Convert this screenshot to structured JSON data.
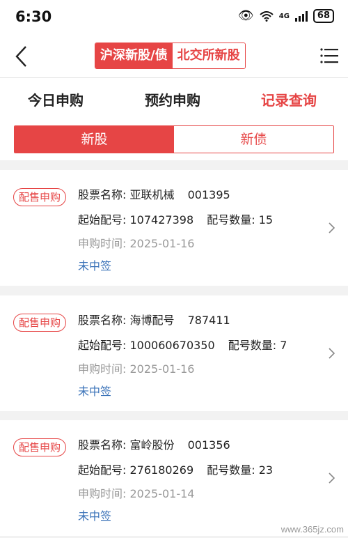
{
  "status_bar": {
    "time": "6:30",
    "signal_label": "4G",
    "battery": "68",
    "icons": [
      "eye-icon",
      "wifi-icon",
      "signal-icon",
      "battery-icon"
    ]
  },
  "navbar": {
    "back_icon": "chevron-left-icon",
    "segments": [
      {
        "label": "沪深新股/债",
        "active": true
      },
      {
        "label": "北交所新股",
        "active": false
      }
    ],
    "menu_icon": "hamburger-menu-icon"
  },
  "tabs": [
    {
      "label": "今日申购",
      "active": false
    },
    {
      "label": "预约申购",
      "active": false
    },
    {
      "label": "记录查询",
      "active": true
    }
  ],
  "subtabs": [
    {
      "label": "新股",
      "active": true
    },
    {
      "label": "新债",
      "active": false
    }
  ],
  "colors": {
    "accent": "#e64545",
    "link_blue": "#3a72b8",
    "muted": "#999999",
    "background": "#f2f2f2"
  },
  "records": [
    {
      "badge": "配售申购",
      "name_label": "股票名称:",
      "name": "亚联机械",
      "code": "001395",
      "start_label": "起始配号:",
      "start_no": "107427398",
      "count_label": "配号数量:",
      "count": "15",
      "time_label": "申购时间:",
      "date": "2025-01-16",
      "result": "未中签"
    },
    {
      "badge": "配售申购",
      "name_label": "股票名称:",
      "name": "海博配号",
      "code": "787411",
      "start_label": "起始配号:",
      "start_no": "100060670350",
      "count_label": "配号数量:",
      "count": "7",
      "time_label": "申购时间:",
      "date": "2025-01-16",
      "result": "未中签"
    },
    {
      "badge": "配售申购",
      "name_label": "股票名称:",
      "name": "富岭股份",
      "code": "001356",
      "start_label": "起始配号:",
      "start_no": "276180269",
      "count_label": "配号数量:",
      "count": "23",
      "time_label": "申购时间:",
      "date": "2025-01-14",
      "result": "未中签"
    }
  ],
  "watermark": "www.365jz.com"
}
